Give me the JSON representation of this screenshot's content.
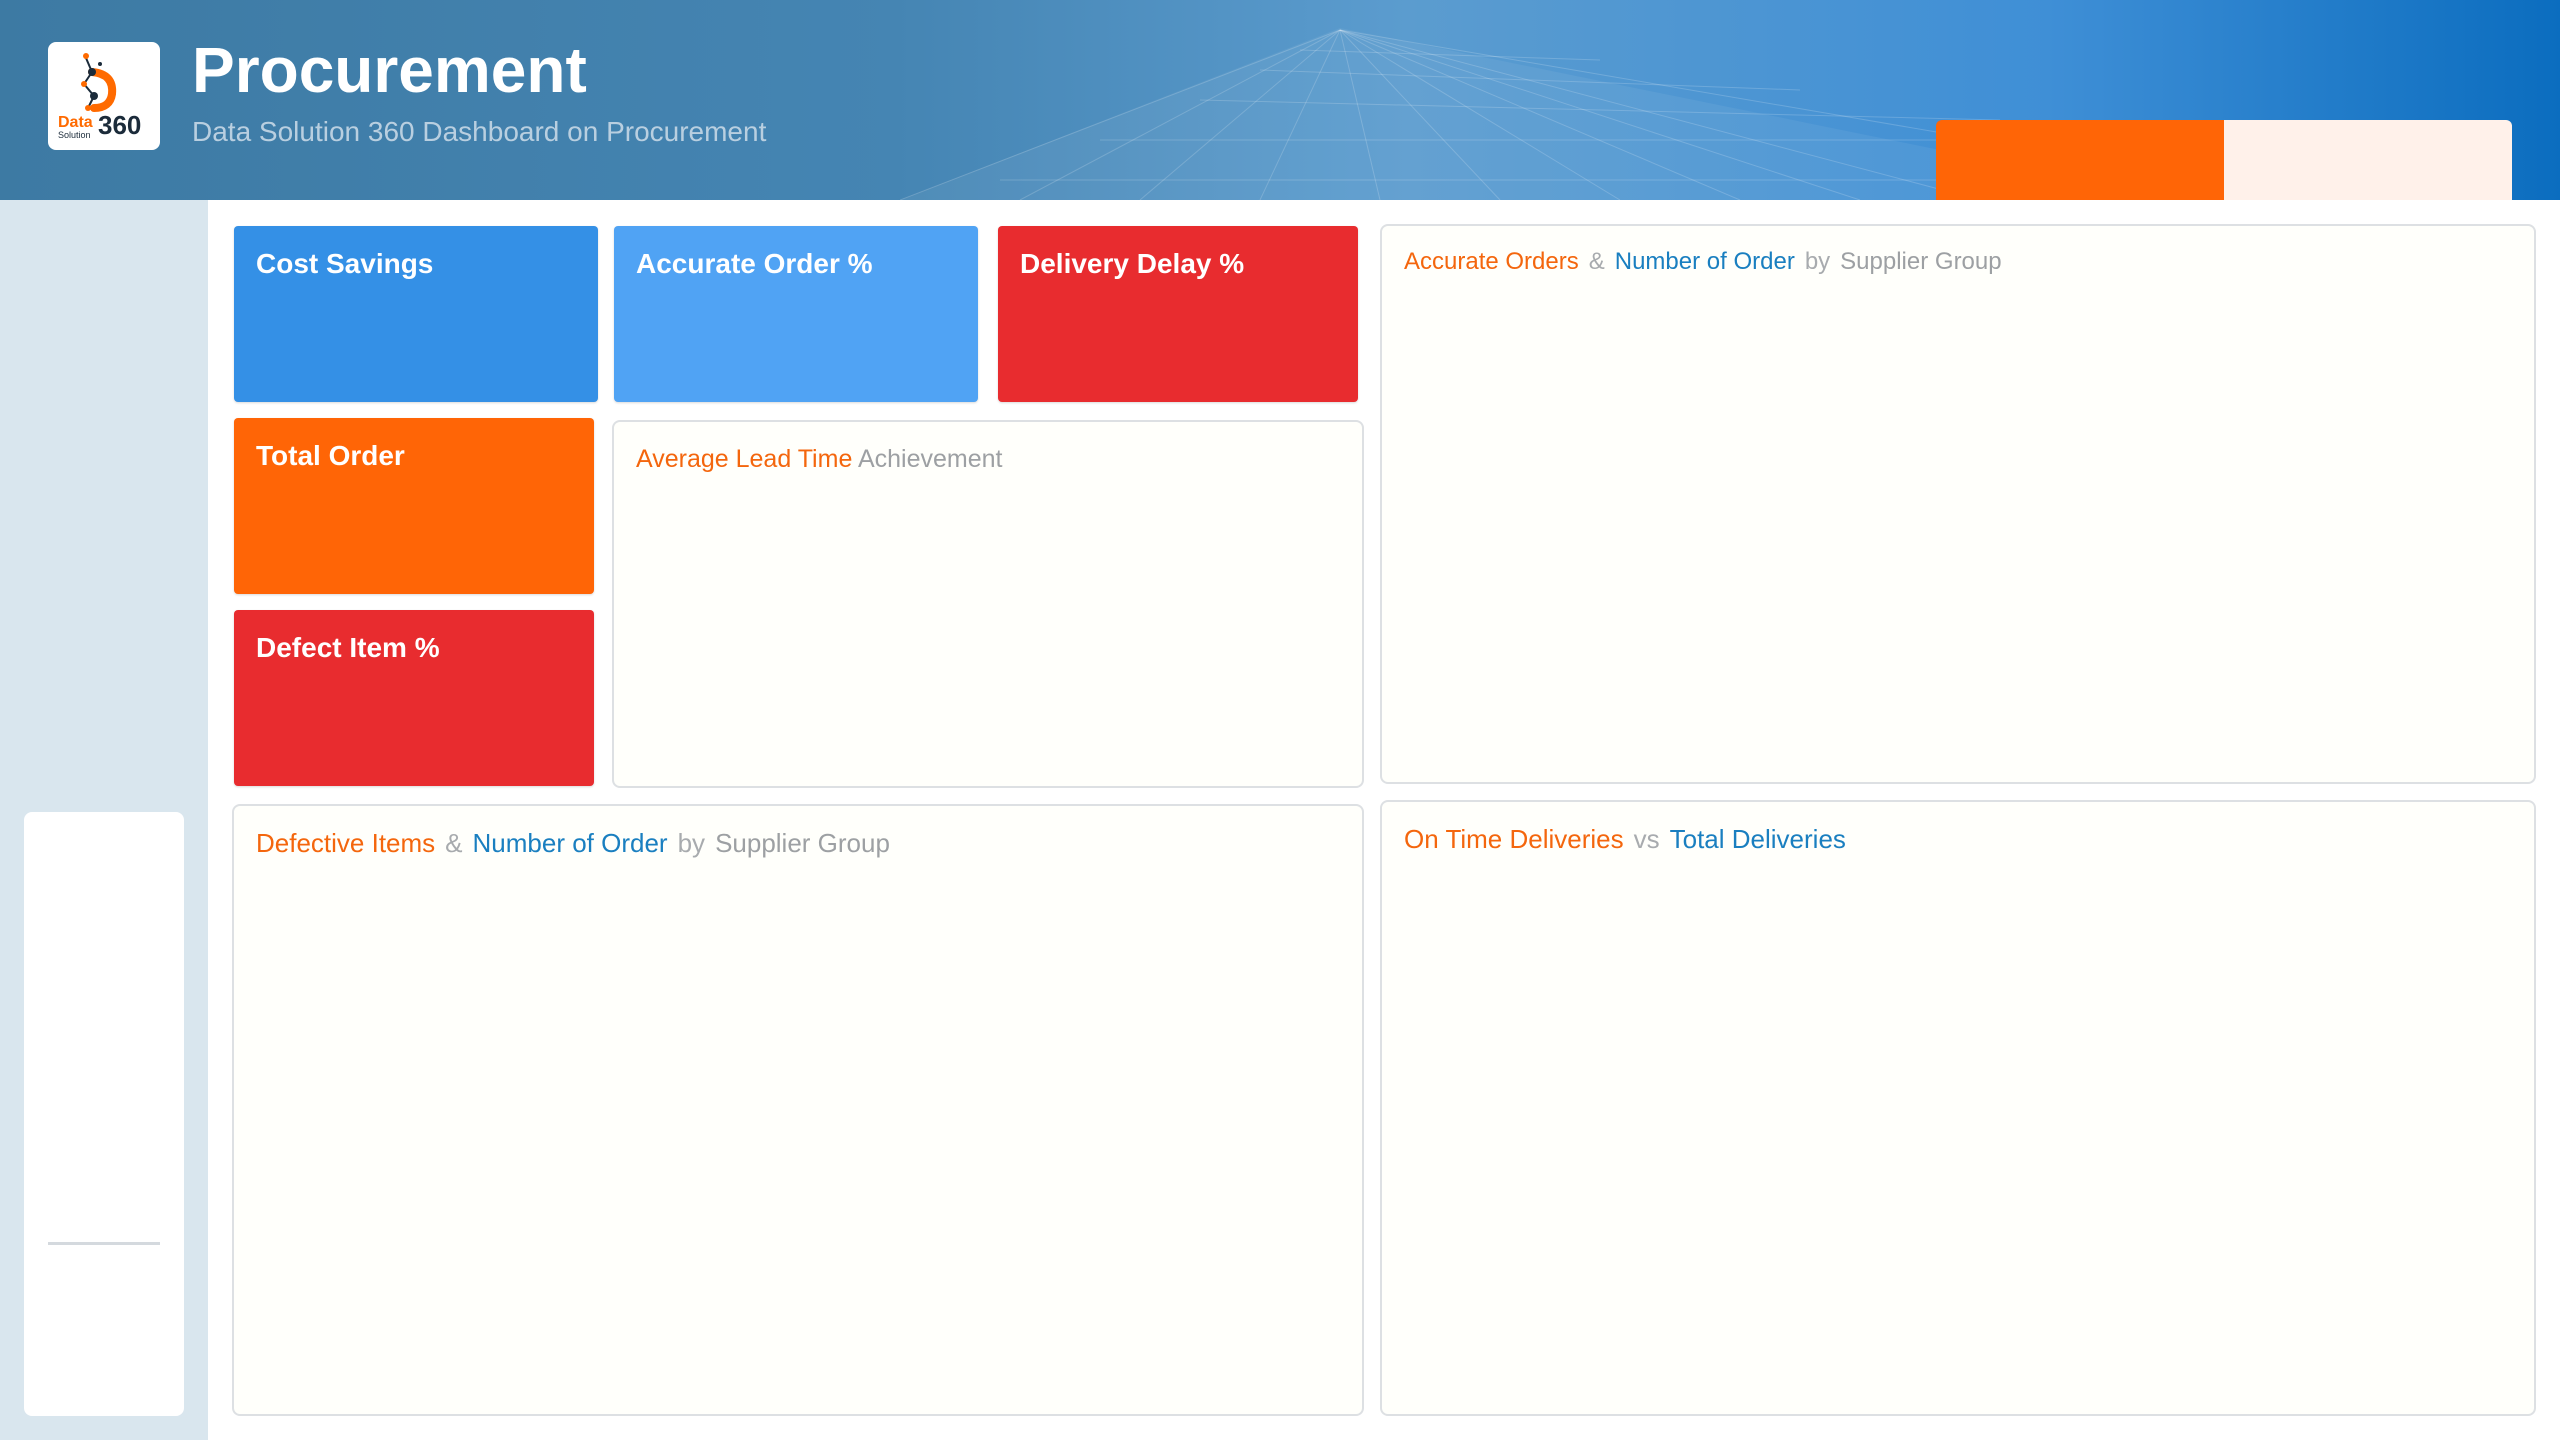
{
  "header": {
    "title": "Procurement",
    "subtitle": "Data Solution 360 Dashboard on Procurement",
    "logo": {
      "icon": "data-solution-360-logo",
      "word_data": "Data",
      "word_solution": "Solution",
      "word_360": "360"
    },
    "colors": {
      "tab_active": "#ff6506",
      "tab_inactive": "#fff1ea"
    }
  },
  "kpis": {
    "cost_savings": {
      "label": "Cost Savings",
      "color": "#3490e6"
    },
    "accurate_order": {
      "label": "Accurate Order %",
      "color": "#50a3f4"
    },
    "delivery_delay": {
      "label": "Delivery Delay %",
      "color": "#e82c2f"
    },
    "total_order": {
      "label": "Total Order",
      "color": "#ff6506"
    },
    "defect_item": {
      "label": "Defect Item %",
      "color": "#e82c2f"
    }
  },
  "panels": {
    "lead_time": {
      "part1": "Average Lead Time",
      "part2": "Achievement"
    },
    "accurate_orders": {
      "part1": "Accurate Orders",
      "sep1": "&",
      "part2": "Number of Order",
      "sep2": "by",
      "part3": "Supplier Group"
    },
    "defective_items": {
      "part1": "Defective Items",
      "sep1": "&",
      "part2": "Number of Order",
      "sep2": "by",
      "part3": "Supplier Group"
    },
    "on_time": {
      "part1": "On Time Deliveries",
      "sep1": "vs",
      "part2": "Total Deliveries"
    }
  }
}
